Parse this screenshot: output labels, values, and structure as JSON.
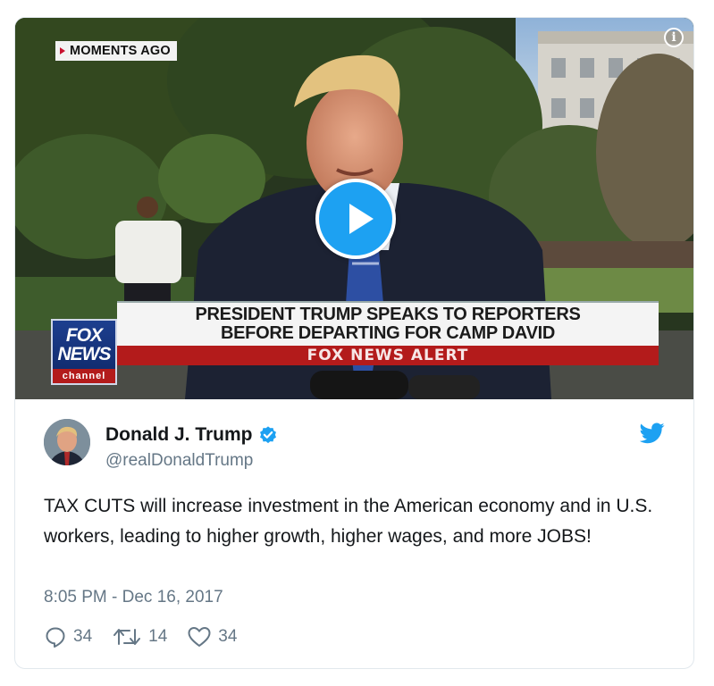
{
  "video": {
    "moments_label": "MOMENTS AGO",
    "headline_line1": "PRESIDENT TRUMP SPEAKS TO REPORTERS",
    "headline_line2": "BEFORE DEPARTING FOR CAMP DAVID",
    "alert_label": "FOX NEWS ALERT",
    "logo_line1": "FOX",
    "logo_line2": "NEWS",
    "logo_line3": "channel",
    "info_glyph": "i",
    "play_icon": "play-icon"
  },
  "tweet": {
    "display_name": "Donald J. Trump",
    "handle": "@realDonaldTrump",
    "text": "TAX CUTS will increase investment in the American economy and in U.S. workers, leading to higher growth, higher wages, and more JOBS!",
    "timestamp": "8:05 PM - Dec 16, 2017",
    "replies": "34",
    "retweets": "14",
    "likes": "34"
  },
  "colors": {
    "twitter_blue": "#1da1f2",
    "secondary_text": "#657786",
    "primary_text": "#14171a",
    "fox_red": "#b31b1b"
  }
}
